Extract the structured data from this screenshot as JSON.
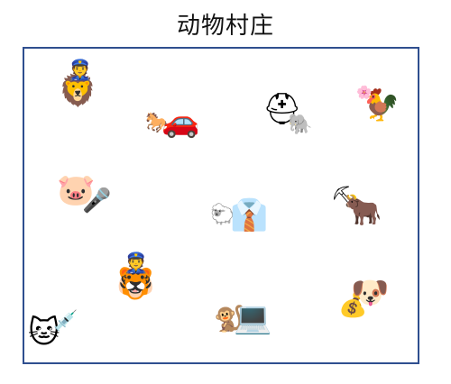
{
  "title": "动物村庄",
  "colors": {
    "frame": "#2f4f8f",
    "text": "#111111"
  },
  "characters": [
    {
      "id": "lion-police",
      "animal": "lion",
      "item": "police-cap",
      "animal_glyph": "🦁",
      "item_glyph": "👮"
    },
    {
      "id": "horse-car",
      "animal": "horse",
      "item": "car",
      "animal_glyph": "🐎",
      "item_glyph": "🚗"
    },
    {
      "id": "elephant-helmet",
      "animal": "elephant",
      "item": "rescue-helmet",
      "animal_glyph": "🐘",
      "item_glyph": "⛑"
    },
    {
      "id": "rooster-flower",
      "animal": "rooster",
      "item": "flower",
      "animal_glyph": "🐓",
      "item_glyph": "🌸"
    },
    {
      "id": "pig-microphone",
      "animal": "pig",
      "item": "microphone",
      "animal_glyph": "🐷",
      "item_glyph": "🎤"
    },
    {
      "id": "sheep-shirt",
      "animal": "sheep",
      "item": "shirt-tie",
      "animal_glyph": "🐑",
      "item_glyph": "👔"
    },
    {
      "id": "ox-pickaxe",
      "animal": "ox",
      "item": "pickaxe",
      "animal_glyph": "🐂",
      "item_glyph": "⛏"
    },
    {
      "id": "tiger-police",
      "animal": "tiger",
      "item": "police-cap",
      "animal_glyph": "🐯",
      "item_glyph": "👮"
    },
    {
      "id": "dog-moneybag",
      "animal": "dog",
      "item": "money-bag",
      "animal_glyph": "🐶",
      "item_glyph": "💰"
    },
    {
      "id": "monkey-laptop",
      "animal": "monkey",
      "item": "laptop",
      "animal_glyph": "🐒",
      "item_glyph": "💻"
    },
    {
      "id": "cat-syringe",
      "animal": "cat",
      "item": "syringe",
      "animal_glyph": "🐱",
      "item_glyph": "💉"
    }
  ]
}
